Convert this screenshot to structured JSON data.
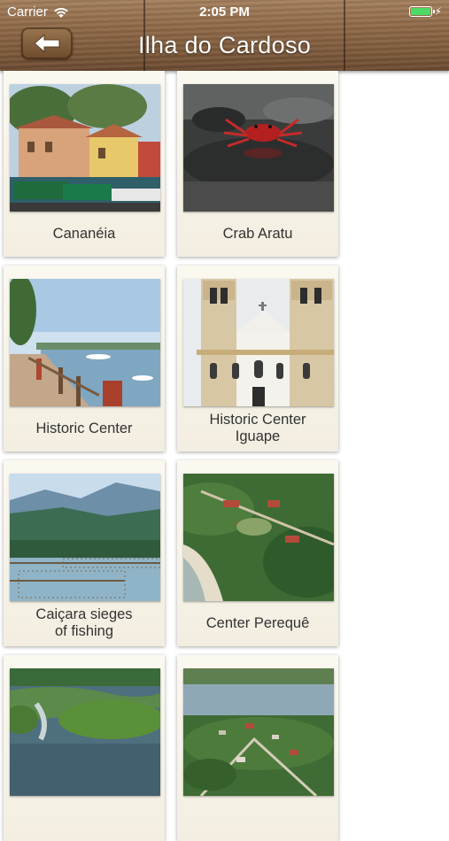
{
  "status_bar": {
    "carrier": "Carrier",
    "time": "2:05 PM",
    "battery_color": "#4cd964"
  },
  "nav": {
    "title": "Ilha do Cardoso",
    "back_icon": "back-arrow-icon"
  },
  "places": [
    {
      "label": "Cananéia"
    },
    {
      "label": "Crab Aratu"
    },
    {
      "label": "Historic Center"
    },
    {
      "label": "Historic Center\nIguape"
    },
    {
      "label": "Caiçara sieges\nof fishing"
    },
    {
      "label": "Center Perequê"
    },
    {
      "label": ""
    },
    {
      "label": ""
    }
  ]
}
